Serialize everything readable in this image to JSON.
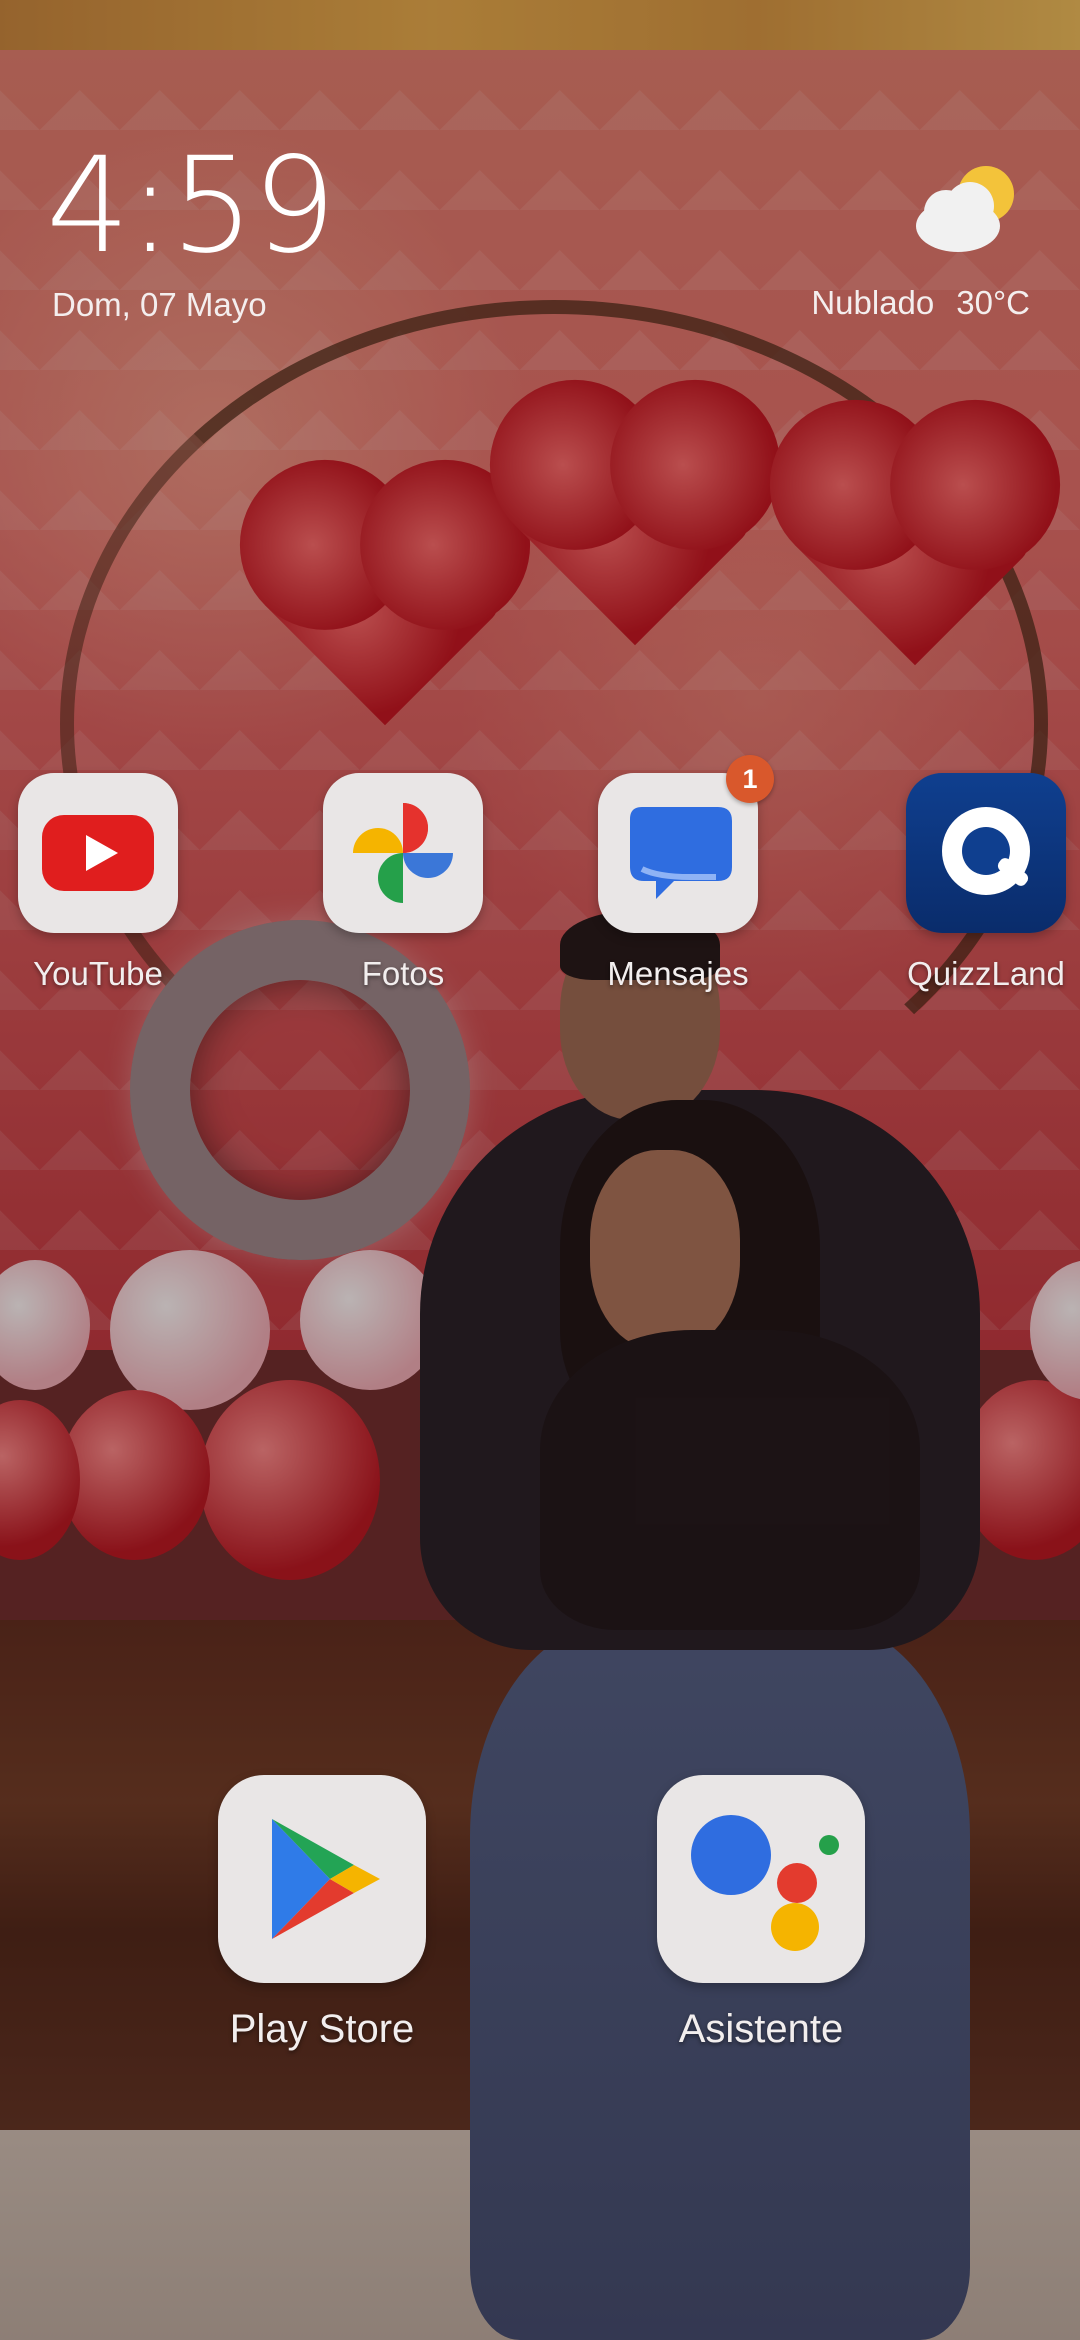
{
  "status": {
    "time": "4:59",
    "date": "Dom, 07 Mayo"
  },
  "weather": {
    "icon": "cloud-sun-icon",
    "condition": "Nublado",
    "temperature": "30°C"
  },
  "apps_row1": [
    {
      "label": "YouTube",
      "icon": "youtube-icon"
    },
    {
      "label": "Fotos",
      "icon": "google-photos-icon"
    },
    {
      "label": "Mensajes",
      "icon": "messages-icon",
      "badge": "1"
    },
    {
      "label": "QuizzLand",
      "icon": "quizzland-icon"
    }
  ],
  "apps_row2": [
    {
      "label": "Play Store",
      "icon": "play-store-icon"
    },
    {
      "label": "Asistente",
      "icon": "assistant-icon"
    }
  ],
  "colors": {
    "badge": "#d9582c",
    "youtube_red": "#e01e1e",
    "quizz_blue": "#0f3f8f"
  }
}
